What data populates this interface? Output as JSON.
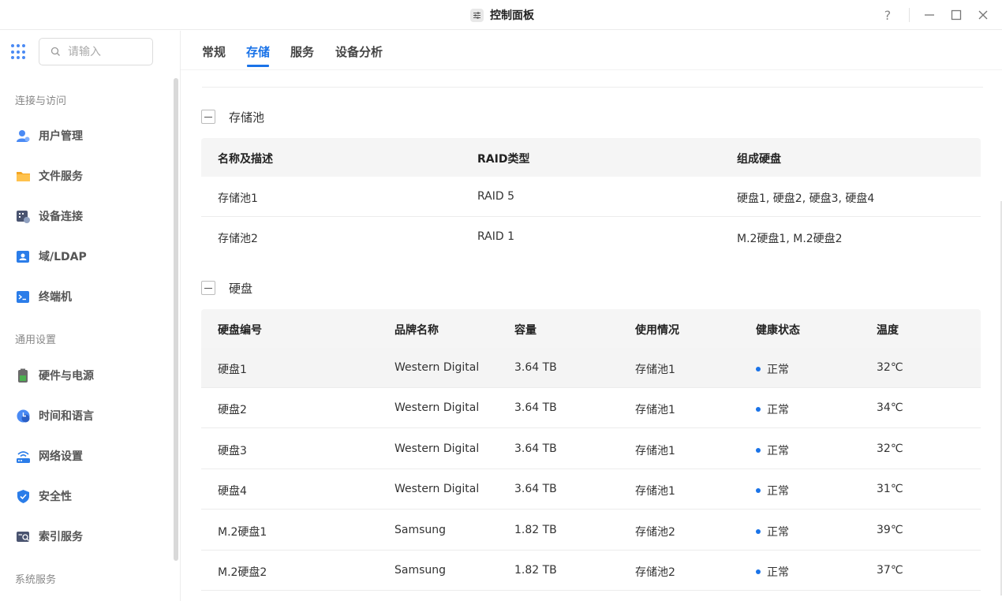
{
  "window": {
    "title": "控制面板",
    "help": "?",
    "minimize": "—",
    "maximize": "☐",
    "close": "✕"
  },
  "search": {
    "placeholder": "请输入"
  },
  "sidebar": {
    "sections": [
      {
        "label": "连接与访问"
      },
      {
        "label": "通用设置"
      },
      {
        "label": "系统服务"
      }
    ],
    "items": [
      {
        "label": "用户管理",
        "icon": "user-icon"
      },
      {
        "label": "文件服务",
        "icon": "folder-icon"
      },
      {
        "label": "设备连接",
        "icon": "device-icon"
      },
      {
        "label": "域/LDAP",
        "icon": "ldap-icon"
      },
      {
        "label": "终端机",
        "icon": "terminal-icon"
      },
      {
        "label": "硬件与电源",
        "icon": "battery-icon"
      },
      {
        "label": "时间和语言",
        "icon": "clock-icon"
      },
      {
        "label": "网络设置",
        "icon": "network-icon"
      },
      {
        "label": "安全性",
        "icon": "shield-icon"
      },
      {
        "label": "索引服务",
        "icon": "index-icon"
      }
    ]
  },
  "tabs": [
    {
      "label": "常规"
    },
    {
      "label": "存储"
    },
    {
      "label": "服务"
    },
    {
      "label": "设备分析"
    }
  ],
  "pools": {
    "title": "存储池",
    "columns": [
      "名称及描述",
      "RAID类型",
      "组成硬盘"
    ],
    "rows": [
      [
        "存储池1",
        "RAID 5",
        "硬盘1, 硬盘2, 硬盘3, 硬盘4"
      ],
      [
        "存储池2",
        "RAID 1",
        "M.2硬盘1, M.2硬盘2"
      ]
    ]
  },
  "disks": {
    "title": "硬盘",
    "columns": [
      "硬盘编号",
      "品牌名称",
      "容量",
      "使用情况",
      "健康状态",
      "温度"
    ],
    "rows": [
      [
        "硬盘1",
        "Western Digital",
        "3.64 TB",
        "存储池1",
        "正常",
        "32℃"
      ],
      [
        "硬盘2",
        "Western Digital",
        "3.64 TB",
        "存储池1",
        "正常",
        "34℃"
      ],
      [
        "硬盘3",
        "Western Digital",
        "3.64 TB",
        "存储池1",
        "正常",
        "32℃"
      ],
      [
        "硬盘4",
        "Western Digital",
        "3.64 TB",
        "存储池1",
        "正常",
        "31℃"
      ],
      [
        "M.2硬盘1",
        "Samsung",
        "1.82 TB",
        "存储池2",
        "正常",
        "39℃"
      ],
      [
        "M.2硬盘2",
        "Samsung",
        "1.82 TB",
        "存储池2",
        "正常",
        "37℃"
      ]
    ]
  },
  "colors": {
    "accent": "#1a73e8"
  }
}
